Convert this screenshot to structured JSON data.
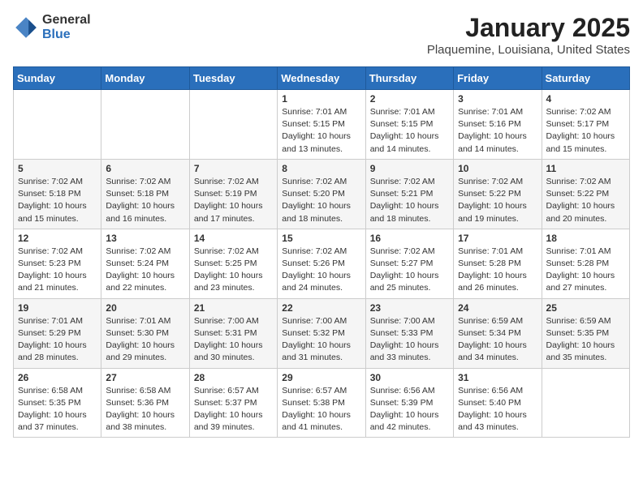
{
  "header": {
    "logo_general": "General",
    "logo_blue": "Blue",
    "month_title": "January 2025",
    "location": "Plaquemine, Louisiana, United States"
  },
  "days_of_week": [
    "Sunday",
    "Monday",
    "Tuesday",
    "Wednesday",
    "Thursday",
    "Friday",
    "Saturday"
  ],
  "weeks": [
    [
      {
        "day": "",
        "info": ""
      },
      {
        "day": "",
        "info": ""
      },
      {
        "day": "",
        "info": ""
      },
      {
        "day": "1",
        "info": "Sunrise: 7:01 AM\nSunset: 5:15 PM\nDaylight: 10 hours\nand 13 minutes."
      },
      {
        "day": "2",
        "info": "Sunrise: 7:01 AM\nSunset: 5:15 PM\nDaylight: 10 hours\nand 14 minutes."
      },
      {
        "day": "3",
        "info": "Sunrise: 7:01 AM\nSunset: 5:16 PM\nDaylight: 10 hours\nand 14 minutes."
      },
      {
        "day": "4",
        "info": "Sunrise: 7:02 AM\nSunset: 5:17 PM\nDaylight: 10 hours\nand 15 minutes."
      }
    ],
    [
      {
        "day": "5",
        "info": "Sunrise: 7:02 AM\nSunset: 5:18 PM\nDaylight: 10 hours\nand 15 minutes."
      },
      {
        "day": "6",
        "info": "Sunrise: 7:02 AM\nSunset: 5:18 PM\nDaylight: 10 hours\nand 16 minutes."
      },
      {
        "day": "7",
        "info": "Sunrise: 7:02 AM\nSunset: 5:19 PM\nDaylight: 10 hours\nand 17 minutes."
      },
      {
        "day": "8",
        "info": "Sunrise: 7:02 AM\nSunset: 5:20 PM\nDaylight: 10 hours\nand 18 minutes."
      },
      {
        "day": "9",
        "info": "Sunrise: 7:02 AM\nSunset: 5:21 PM\nDaylight: 10 hours\nand 18 minutes."
      },
      {
        "day": "10",
        "info": "Sunrise: 7:02 AM\nSunset: 5:22 PM\nDaylight: 10 hours\nand 19 minutes."
      },
      {
        "day": "11",
        "info": "Sunrise: 7:02 AM\nSunset: 5:22 PM\nDaylight: 10 hours\nand 20 minutes."
      }
    ],
    [
      {
        "day": "12",
        "info": "Sunrise: 7:02 AM\nSunset: 5:23 PM\nDaylight: 10 hours\nand 21 minutes."
      },
      {
        "day": "13",
        "info": "Sunrise: 7:02 AM\nSunset: 5:24 PM\nDaylight: 10 hours\nand 22 minutes."
      },
      {
        "day": "14",
        "info": "Sunrise: 7:02 AM\nSunset: 5:25 PM\nDaylight: 10 hours\nand 23 minutes."
      },
      {
        "day": "15",
        "info": "Sunrise: 7:02 AM\nSunset: 5:26 PM\nDaylight: 10 hours\nand 24 minutes."
      },
      {
        "day": "16",
        "info": "Sunrise: 7:02 AM\nSunset: 5:27 PM\nDaylight: 10 hours\nand 25 minutes."
      },
      {
        "day": "17",
        "info": "Sunrise: 7:01 AM\nSunset: 5:28 PM\nDaylight: 10 hours\nand 26 minutes."
      },
      {
        "day": "18",
        "info": "Sunrise: 7:01 AM\nSunset: 5:28 PM\nDaylight: 10 hours\nand 27 minutes."
      }
    ],
    [
      {
        "day": "19",
        "info": "Sunrise: 7:01 AM\nSunset: 5:29 PM\nDaylight: 10 hours\nand 28 minutes."
      },
      {
        "day": "20",
        "info": "Sunrise: 7:01 AM\nSunset: 5:30 PM\nDaylight: 10 hours\nand 29 minutes."
      },
      {
        "day": "21",
        "info": "Sunrise: 7:00 AM\nSunset: 5:31 PM\nDaylight: 10 hours\nand 30 minutes."
      },
      {
        "day": "22",
        "info": "Sunrise: 7:00 AM\nSunset: 5:32 PM\nDaylight: 10 hours\nand 31 minutes."
      },
      {
        "day": "23",
        "info": "Sunrise: 7:00 AM\nSunset: 5:33 PM\nDaylight: 10 hours\nand 33 minutes."
      },
      {
        "day": "24",
        "info": "Sunrise: 6:59 AM\nSunset: 5:34 PM\nDaylight: 10 hours\nand 34 minutes."
      },
      {
        "day": "25",
        "info": "Sunrise: 6:59 AM\nSunset: 5:35 PM\nDaylight: 10 hours\nand 35 minutes."
      }
    ],
    [
      {
        "day": "26",
        "info": "Sunrise: 6:58 AM\nSunset: 5:35 PM\nDaylight: 10 hours\nand 37 minutes."
      },
      {
        "day": "27",
        "info": "Sunrise: 6:58 AM\nSunset: 5:36 PM\nDaylight: 10 hours\nand 38 minutes."
      },
      {
        "day": "28",
        "info": "Sunrise: 6:57 AM\nSunset: 5:37 PM\nDaylight: 10 hours\nand 39 minutes."
      },
      {
        "day": "29",
        "info": "Sunrise: 6:57 AM\nSunset: 5:38 PM\nDaylight: 10 hours\nand 41 minutes."
      },
      {
        "day": "30",
        "info": "Sunrise: 6:56 AM\nSunset: 5:39 PM\nDaylight: 10 hours\nand 42 minutes."
      },
      {
        "day": "31",
        "info": "Sunrise: 6:56 AM\nSunset: 5:40 PM\nDaylight: 10 hours\nand 43 minutes."
      },
      {
        "day": "",
        "info": ""
      }
    ]
  ]
}
